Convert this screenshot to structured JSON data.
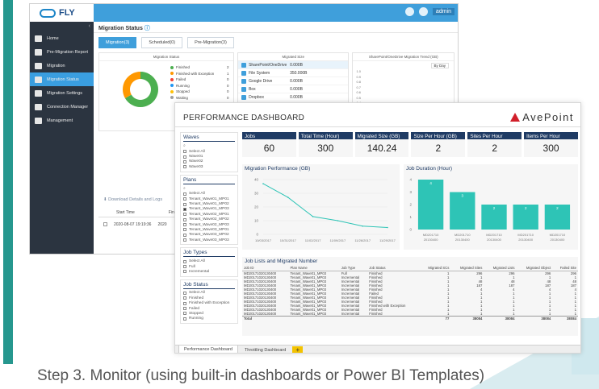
{
  "caption": "Step 3. Monitor (using built-in dashboards or Power BI Templates)",
  "fly": {
    "logo_text": "FLY",
    "admin_label": "admin",
    "page_title": "Migration Status",
    "nav": [
      {
        "label": "Home",
        "icon": "home-icon"
      },
      {
        "label": "Pre-Migration Report",
        "icon": "report-icon"
      },
      {
        "label": "Migration",
        "icon": "migration-icon"
      },
      {
        "label": "Migration Status",
        "icon": "status-icon"
      },
      {
        "label": "Migration Settings",
        "icon": "settings-icon"
      },
      {
        "label": "Connection Manager",
        "icon": "connection-icon"
      },
      {
        "label": "Management",
        "icon": "management-icon"
      }
    ],
    "tabs": [
      "Migration(3)",
      "Scheduled(0)",
      "Pre-Migration(3)"
    ],
    "status_panel": {
      "title": "Migration Status",
      "items": [
        {
          "label": "Finished",
          "value": "2",
          "color": "#4caf50"
        },
        {
          "label": "Finished with Exception",
          "value": "1",
          "color": "#ff9800"
        },
        {
          "label": "Failed",
          "value": "0",
          "color": "#f44336"
        },
        {
          "label": "Running",
          "value": "0",
          "color": "#2196f3"
        },
        {
          "label": "Stopped",
          "value": "0",
          "color": "#ffc107"
        },
        {
          "label": "Waiting",
          "value": "0",
          "color": "#9e9e9e"
        }
      ]
    },
    "size_panel": {
      "title": "Migrated Size",
      "items": [
        {
          "label": "SharePoint/OneDrive",
          "value": "0.000B"
        },
        {
          "label": "File System",
          "value": "350.000B"
        },
        {
          "label": "Google Drive",
          "value": "0.000B"
        },
        {
          "label": "Box",
          "value": "0.000B"
        },
        {
          "label": "Dropbox",
          "value": "0.000B"
        }
      ]
    },
    "trend_panel": {
      "title": "SharePoint/OneDrive Migration Trend (GB)",
      "range": "By Day",
      "y_ticks": [
        "1.0",
        "0.9",
        "0.8",
        "0.7",
        "0.6",
        "0.5",
        "0.4",
        "0.3",
        "0.2",
        "0.1",
        "0"
      ]
    },
    "download_link": "Download Details and Logs",
    "table_header": [
      "Start Time",
      "Fini"
    ],
    "table_row": [
      "2020-08-07 19:19:36",
      "2020"
    ]
  },
  "dashboard": {
    "title": "PERFORMANCE DASHBOARD",
    "brand": "AvePoint",
    "filters": [
      {
        "title": "Waves",
        "search": "⌕",
        "items": [
          {
            "label": "Select All",
            "checked": false
          },
          {
            "label": "Wave01",
            "checked": false
          },
          {
            "label": "Wave02",
            "checked": false
          },
          {
            "label": "Wave03",
            "checked": false
          }
        ]
      },
      {
        "title": "Plans",
        "search": "⌕",
        "items": [
          {
            "label": "Select All",
            "checked": false
          },
          {
            "label": "Tenant_Wave01_MP01",
            "checked": false
          },
          {
            "label": "Tenant_Wave01_MP02",
            "checked": false
          },
          {
            "label": "Tenant_Wave01_MP03",
            "checked": true
          },
          {
            "label": "Tenant_Wave02_MP01",
            "checked": false
          },
          {
            "label": "Tenant_Wave02_MP02",
            "checked": false
          },
          {
            "label": "Tenant_Wave02_MP03",
            "checked": false
          },
          {
            "label": "Tenant_Wave03_MP01",
            "checked": false
          },
          {
            "label": "Tenant_Wave03_MP02",
            "checked": false
          },
          {
            "label": "Tenant_Wave03_MP03",
            "checked": false
          }
        ]
      },
      {
        "title": "Job Types",
        "search": "",
        "items": [
          {
            "label": "Select All",
            "checked": false
          },
          {
            "label": "Full",
            "checked": false
          },
          {
            "label": "Incremental",
            "checked": false
          }
        ]
      },
      {
        "title": "Job Status",
        "search": "",
        "items": [
          {
            "label": "Select All",
            "checked": false
          },
          {
            "label": "Finished",
            "checked": false
          },
          {
            "label": "Finished with Exception",
            "checked": false
          },
          {
            "label": "Failed",
            "checked": false
          },
          {
            "label": "Stopped",
            "checked": false
          },
          {
            "label": "Running",
            "checked": false
          }
        ]
      }
    ],
    "kpis": [
      {
        "label": "Jobs",
        "value": "60"
      },
      {
        "label": "Total Time (Hour)",
        "value": "300"
      },
      {
        "label": "Migrated Size (GB)",
        "value": "140.24"
      },
      {
        "label": "Size Per Hour (GB)",
        "value": "2"
      },
      {
        "label": "Sites Per Hour",
        "value": "2"
      },
      {
        "label": "Items Per Hour",
        "value": "300"
      }
    ],
    "migration_title": "Migration Performance (GB)",
    "duration_title": "Job Duration (Hour)",
    "jobs_title": "Job Lists and Migrated Number",
    "jobs_columns": [
      "Job ID",
      "Plan Name",
      "Job Type",
      "Job Status",
      "Migrated SCs",
      "Migrated Sites",
      "Migrated Lists",
      "Migrated Object",
      "Failed Site"
    ],
    "jobs_rows": [
      [
        "MD20171020130400",
        "Tenant_Wave01_MP03",
        "Full",
        "Finished",
        "1",
        "296",
        "296",
        "296",
        "296"
      ],
      [
        "MD20171020130400",
        "Tenant_Wave01_MP03",
        "Incremental",
        "Finished",
        "1",
        "1",
        "1",
        "1",
        "1"
      ],
      [
        "MD20171020130400",
        "Tenant_Wave01_MP03",
        "Incremental",
        "Finished",
        "1",
        "48",
        "48",
        "48",
        "48"
      ],
      [
        "MD20171020130400",
        "Tenant_Wave01_MP03",
        "Incremental",
        "Finished",
        "1",
        "187",
        "187",
        "187",
        "187"
      ],
      [
        "MD20171020130400",
        "Tenant_Wave01_MP03",
        "Incremental",
        "Finished",
        "1",
        "4",
        "4",
        "4",
        "4"
      ],
      [
        "MD20171020130400",
        "Tenant_Wave01_MP03",
        "Incremental",
        "Failed",
        "1",
        "1",
        "1",
        "1",
        "1"
      ],
      [
        "MD20171020130400",
        "Tenant_Wave01_MP03",
        "Incremental",
        "Finished",
        "1",
        "1",
        "1",
        "1",
        "1"
      ],
      [
        "MD20171020130400",
        "Tenant_Wave01_MP03",
        "Incremental",
        "Finished",
        "1",
        "1",
        "1",
        "1",
        "1"
      ],
      [
        "MD20171020130400",
        "Tenant_Wave01_MP03",
        "Incremental",
        "Finished with Exception",
        "1",
        "1",
        "1",
        "1",
        "1"
      ],
      [
        "MD20171020130400",
        "Tenant_Wave01_MP03",
        "Incremental",
        "Finished",
        "1",
        "1",
        "1",
        "1",
        "1"
      ],
      [
        "MD20171020130400",
        "Tenant_Wave01_MP03",
        "Incremental",
        "Finished",
        "1",
        "1",
        "1",
        "1",
        "1"
      ]
    ],
    "jobs_total": [
      "Total",
      "",
      "",
      "",
      "77",
      "38084",
      "38084",
      "38084",
      "38084"
    ],
    "tabs": [
      "Performance Dashboard",
      "Throttling Dashboard"
    ],
    "add_tab": "+"
  },
  "chart_data": [
    {
      "type": "line",
      "title": "Migration Performance (GB)",
      "x": [
        "10/03/2017",
        "10/31/2017",
        "11/02/2017",
        "11/09/2017",
        "11/26/2017",
        "11/29/2017"
      ],
      "series": [
        {
          "values": [
            37,
            27,
            13,
            10,
            6,
            5
          ]
        }
      ],
      "y_ticks": [
        "0",
        "10",
        "20",
        "30",
        "40"
      ],
      "ylim": [
        0,
        40
      ],
      "color": "#2ec4b6"
    },
    {
      "type": "bar",
      "title": "Job Duration (Hour)",
      "categories": [
        "MD201710 20130400",
        "MD201710 20130400",
        "MD201710 20130400",
        "MD201710 20130400",
        "MD201710 20130400"
      ],
      "values": [
        4,
        3,
        2,
        2,
        2
      ],
      "y_ticks": [
        "0",
        "1",
        "2",
        "3",
        "4"
      ],
      "ylim": [
        0,
        4
      ],
      "color": "#2ec4b6"
    },
    {
      "type": "pie",
      "title": "Migration Status",
      "categories": [
        "Finished",
        "Finished with Exception"
      ],
      "values": [
        2,
        1
      ],
      "colors": [
        "#4caf50",
        "#ff9800"
      ]
    }
  ]
}
